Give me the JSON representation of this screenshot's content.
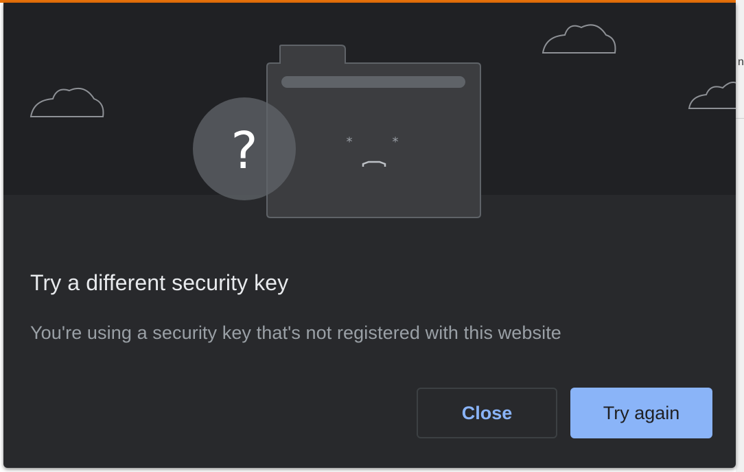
{
  "dialog": {
    "title": "Try a different security key",
    "description": "You're using a security key that's not registered with this website",
    "buttons": {
      "close_label": "Close",
      "try_again_label": "Try again"
    },
    "illustration": {
      "question_mark": "?",
      "icons": [
        "cloud-icon",
        "cloud-icon",
        "cloud-icon",
        "sad-folder-icon",
        "question-circle-icon"
      ]
    }
  },
  "colors": {
    "dialog_background": "#28292c",
    "illustration_background": "#202124",
    "title_text": "#e8eaed",
    "description_text": "#9aa0a6",
    "accent_blue": "#8ab4f8",
    "top_accent": "#e8710a"
  }
}
